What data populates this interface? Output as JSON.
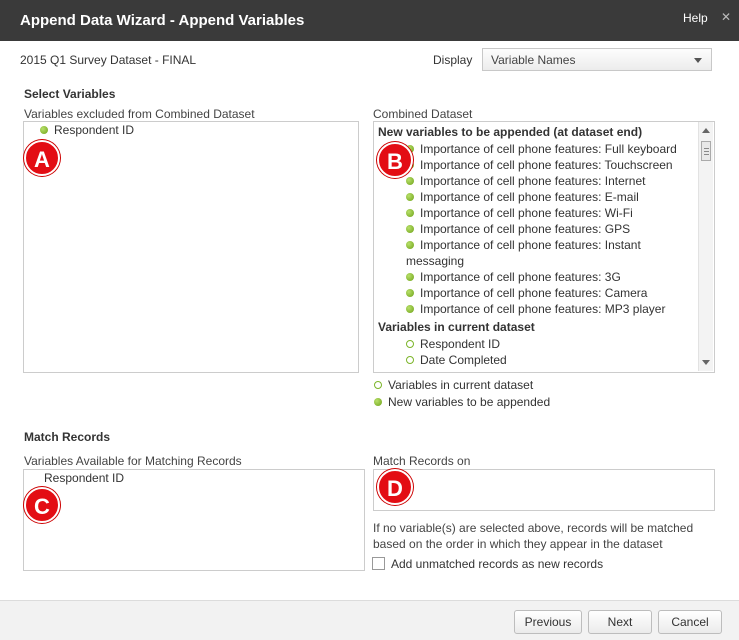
{
  "titlebar": {
    "title": "Append Data Wizard - Append Variables",
    "help": "Help",
    "close_glyph": "✕"
  },
  "header": {
    "dataset_name": "2015 Q1 Survey Dataset - FINAL",
    "display_label": "Display",
    "display_value": "Variable Names"
  },
  "select_variables": {
    "section_title": "Select Variables",
    "excluded_label": "Variables excluded from Combined Dataset",
    "excluded_items": [
      "Respondent ID"
    ],
    "combined_label": "Combined Dataset",
    "new_group_title": "New variables to be appended (at dataset end)",
    "new_items": [
      "Importance of cell phone features: Full keyboard",
      "Importance of cell phone features: Touchscreen",
      "Importance of cell phone features: Internet",
      "Importance of cell phone features: E-mail",
      "Importance of cell phone features: Wi-Fi",
      "Importance of cell phone features: GPS",
      "Importance of cell phone features: Instant",
      "messaging",
      "Importance of cell phone features: 3G",
      "Importance of cell phone features: Camera",
      "Importance of cell phone features: MP3 player"
    ],
    "current_group_title": "Variables in current dataset",
    "current_items": [
      "Respondent ID",
      "Date Completed"
    ],
    "legend_current": "Variables in current dataset",
    "legend_new": "New variables to be appended"
  },
  "match_records": {
    "section_title": "Match Records",
    "available_label": "Variables Available for Matching Records",
    "available_items": [
      "Respondent ID"
    ],
    "match_on_label": "Match Records on",
    "note_line1": "If no variable(s) are selected above, records will be matched",
    "note_line2": "based on the order in which they appear in the dataset",
    "checkbox_label": "Add unmatched records as new records"
  },
  "badges": {
    "a": "A",
    "b": "B",
    "c": "C",
    "d": "D"
  },
  "footer": {
    "previous": "Previous",
    "next": "Next",
    "cancel": "Cancel"
  },
  "colors": {
    "titlebar": "#3a3a3a",
    "badge": "#e30d14",
    "dot_green": "#7cb52a"
  }
}
